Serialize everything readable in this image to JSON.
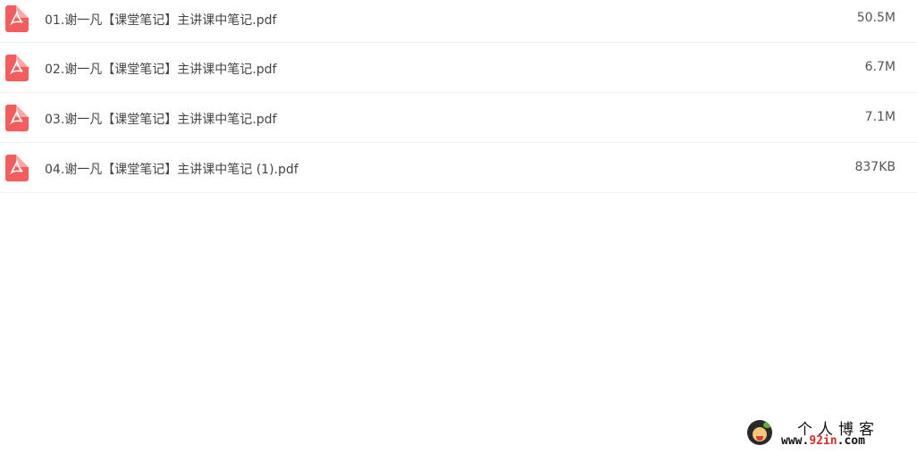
{
  "files": [
    {
      "name": "01.谢一凡【课堂笔记】主讲课中笔记.pdf",
      "size": "50.5M",
      "icon": "pdf-icon"
    },
    {
      "name": "02.谢一凡【课堂笔记】主讲课中笔记.pdf",
      "size": "6.7M",
      "icon": "pdf-icon"
    },
    {
      "name": "03.谢一凡【课堂笔记】主讲课中笔记.pdf",
      "size": "7.1M",
      "icon": "pdf-icon"
    },
    {
      "name": "04.谢一凡【课堂笔记】主讲课中笔记 (1).pdf",
      "size": "837KB",
      "icon": "pdf-icon"
    }
  ],
  "watermark": {
    "title": "个人博客",
    "url_prefix": "www.",
    "url_accent": "92in",
    "url_suffix": ".com"
  },
  "colors": {
    "pdf_icon": "#f25d5d",
    "row_divider": "#f0f0f0",
    "text": "#444444",
    "watermark_accent": "#d62b2b"
  }
}
